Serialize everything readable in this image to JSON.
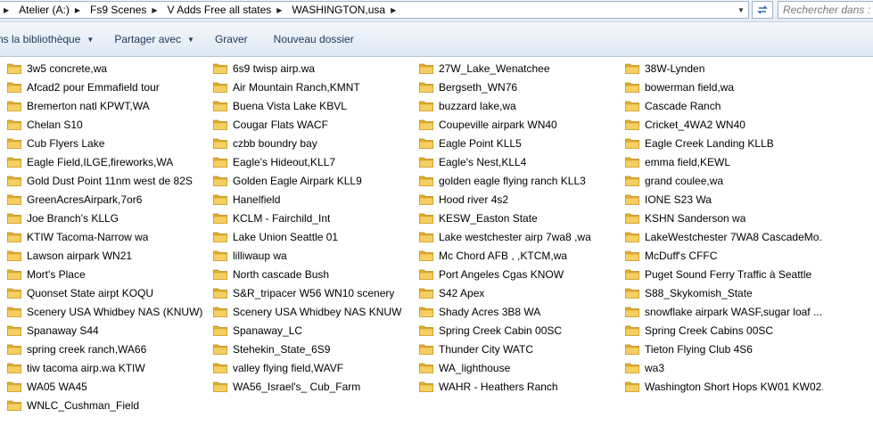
{
  "address_bar": {
    "crumbs": [
      "Atelier (A:)",
      "Fs9 Scenes",
      "V Adds Free all states",
      "WASHINGTON,usa"
    ],
    "search_placeholder": "Rechercher dans :"
  },
  "toolbar": {
    "library_label": "ns la bibliothèque",
    "share_label": "Partager avec",
    "burn_label": "Graver",
    "new_folder_label": "Nouveau dossier"
  },
  "colors": {
    "folder_yellow": "#f4c64e",
    "toolbar_text": "#1e395b",
    "selection_border": "#9fb1c8"
  },
  "folders": [
    [
      "3w5 concrete,wa",
      "Afcad2 pour Emmafield tour",
      "Bremerton natl KPWT,WA",
      "Chelan S10",
      "Cub Flyers Lake",
      "Eagle Field,ILGE,fireworks,WA",
      "Gold Dust Point 11nm west de 82S",
      "GreenAcresAirpark,7or6",
      "Joe Branch's KLLG",
      "KTIW Tacoma-Narrow wa",
      "Lawson airpark WN21",
      "Mort's Place",
      "Quonset State airpt KOQU",
      "Scenery USA Whidbey NAS (KNUW)",
      "Spanaway S44",
      "spring creek ranch,WA66",
      "tiw tacoma airp.wa KTIW",
      "WA05 WA45",
      "WNLC_Cushman_Field"
    ],
    [
      "6s9 twisp airp.wa",
      "Air Mountain Ranch,KMNT",
      "Buena Vista Lake KBVL",
      "Cougar Flats WACF",
      "czbb boundry bay",
      "Eagle's Hideout,KLL7",
      "Golden Eagle Airpark KLL9",
      "Hanelfield",
      "KCLM - Fairchild_Int",
      "Lake Union Seattle 01",
      "lilliwaup wa",
      "North cascade Bush",
      "S&R_tripacer W56 WN10 scenery",
      "Scenery USA Whidbey NAS KNUW",
      "Spanaway_LC",
      "Stehekin_State_6S9",
      "valley flying field,WAVF",
      "WA56_Israel's_ Cub_Farm"
    ],
    [
      "27W_Lake_Wenatchee",
      "Bergseth_WN76",
      "buzzard lake,wa",
      "Coupeville airpark WN40",
      "Eagle  Point KLL5",
      "Eagle's Nest,KLL4",
      "golden eagle flying ranch KLL3",
      "Hood river 4s2",
      "KESW_Easton State",
      "Lake westchester airp  7wa8 ,wa",
      "Mc Chord AFB , ,KTCM,wa",
      "Port Angeles Cgas KNOW",
      "S42 Apex",
      "Shady Acres 3B8 WA",
      "Spring Creek Cabin 00SC",
      "Thunder City WATC",
      "WA_lighthouse",
      "WAHR - Heathers Ranch"
    ],
    [
      "38W-Lynden",
      "bowerman field,wa",
      "Cascade Ranch",
      "Cricket_4WA2 WN40",
      "Eagle Creek Landing KLLB",
      "emma field,KEWL",
      "grand coulee,wa",
      "IONE S23 Wa",
      "KSHN Sanderson wa",
      "LakeWestchester 7WA8 CascadeMo...",
      "McDuff's CFFC",
      "Puget Sound Ferry Traffic à Seattle",
      "S88_Skykomish_State",
      "snowflake airpark WASF,sugar loaf ...",
      "Spring Creek Cabins 00SC",
      "Tieton Flying Club 4S6",
      "wa3",
      "Washington Short Hops KW01 KW02..."
    ]
  ]
}
